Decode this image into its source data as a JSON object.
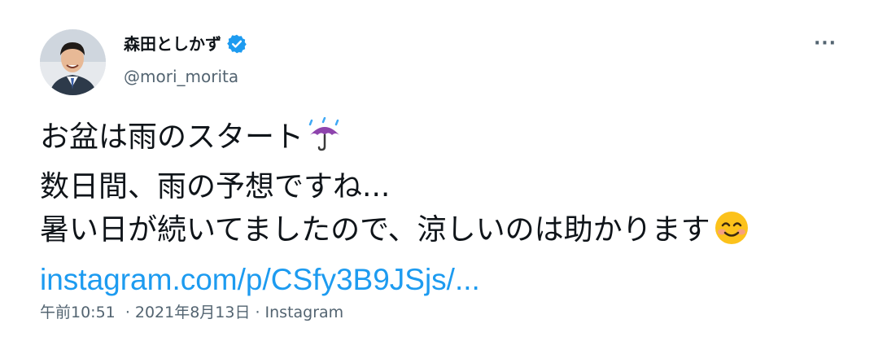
{
  "author": {
    "display_name": "森田としかず",
    "handle": "@mori_morita",
    "verified": true
  },
  "more_menu": {
    "label": "···"
  },
  "tweet": {
    "lines": [
      {
        "text": "お盆は雨のスタート",
        "emoji": "umbrella-with-rain-icon"
      },
      {
        "text": "数日間、雨の予想ですね..."
      },
      {
        "text": "暑い日が続いてましたので、涼しいのは助かります",
        "emoji": "smiling-face-icon"
      }
    ],
    "link": "instagram.com/p/CSfy3B9JSjs/..."
  },
  "meta": {
    "time": "午前10:51",
    "date": "2021年8月13日",
    "source": "Instagram",
    "separator": "·"
  },
  "colors": {
    "link": "#1d9bf0",
    "secondary_text": "#536471",
    "verified_badge": "#1d9bf0",
    "umbrella": "#8e44ad"
  }
}
